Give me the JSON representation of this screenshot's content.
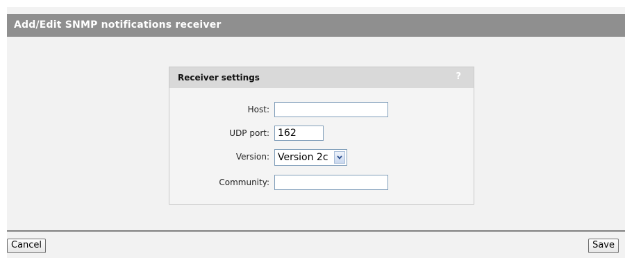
{
  "header": {
    "title": "Add/Edit SNMP notifications receiver"
  },
  "receiver_settings": {
    "title": "Receiver settings",
    "help_label": "?",
    "fields": {
      "host": {
        "label": "Host:",
        "value": ""
      },
      "udp_port": {
        "label": "UDP port:",
        "value": "162"
      },
      "version": {
        "label": "Version:",
        "value": "Version 2c"
      },
      "community": {
        "label": "Community:",
        "value": ""
      }
    }
  },
  "footer": {
    "cancel_label": "Cancel",
    "save_label": "Save"
  }
}
